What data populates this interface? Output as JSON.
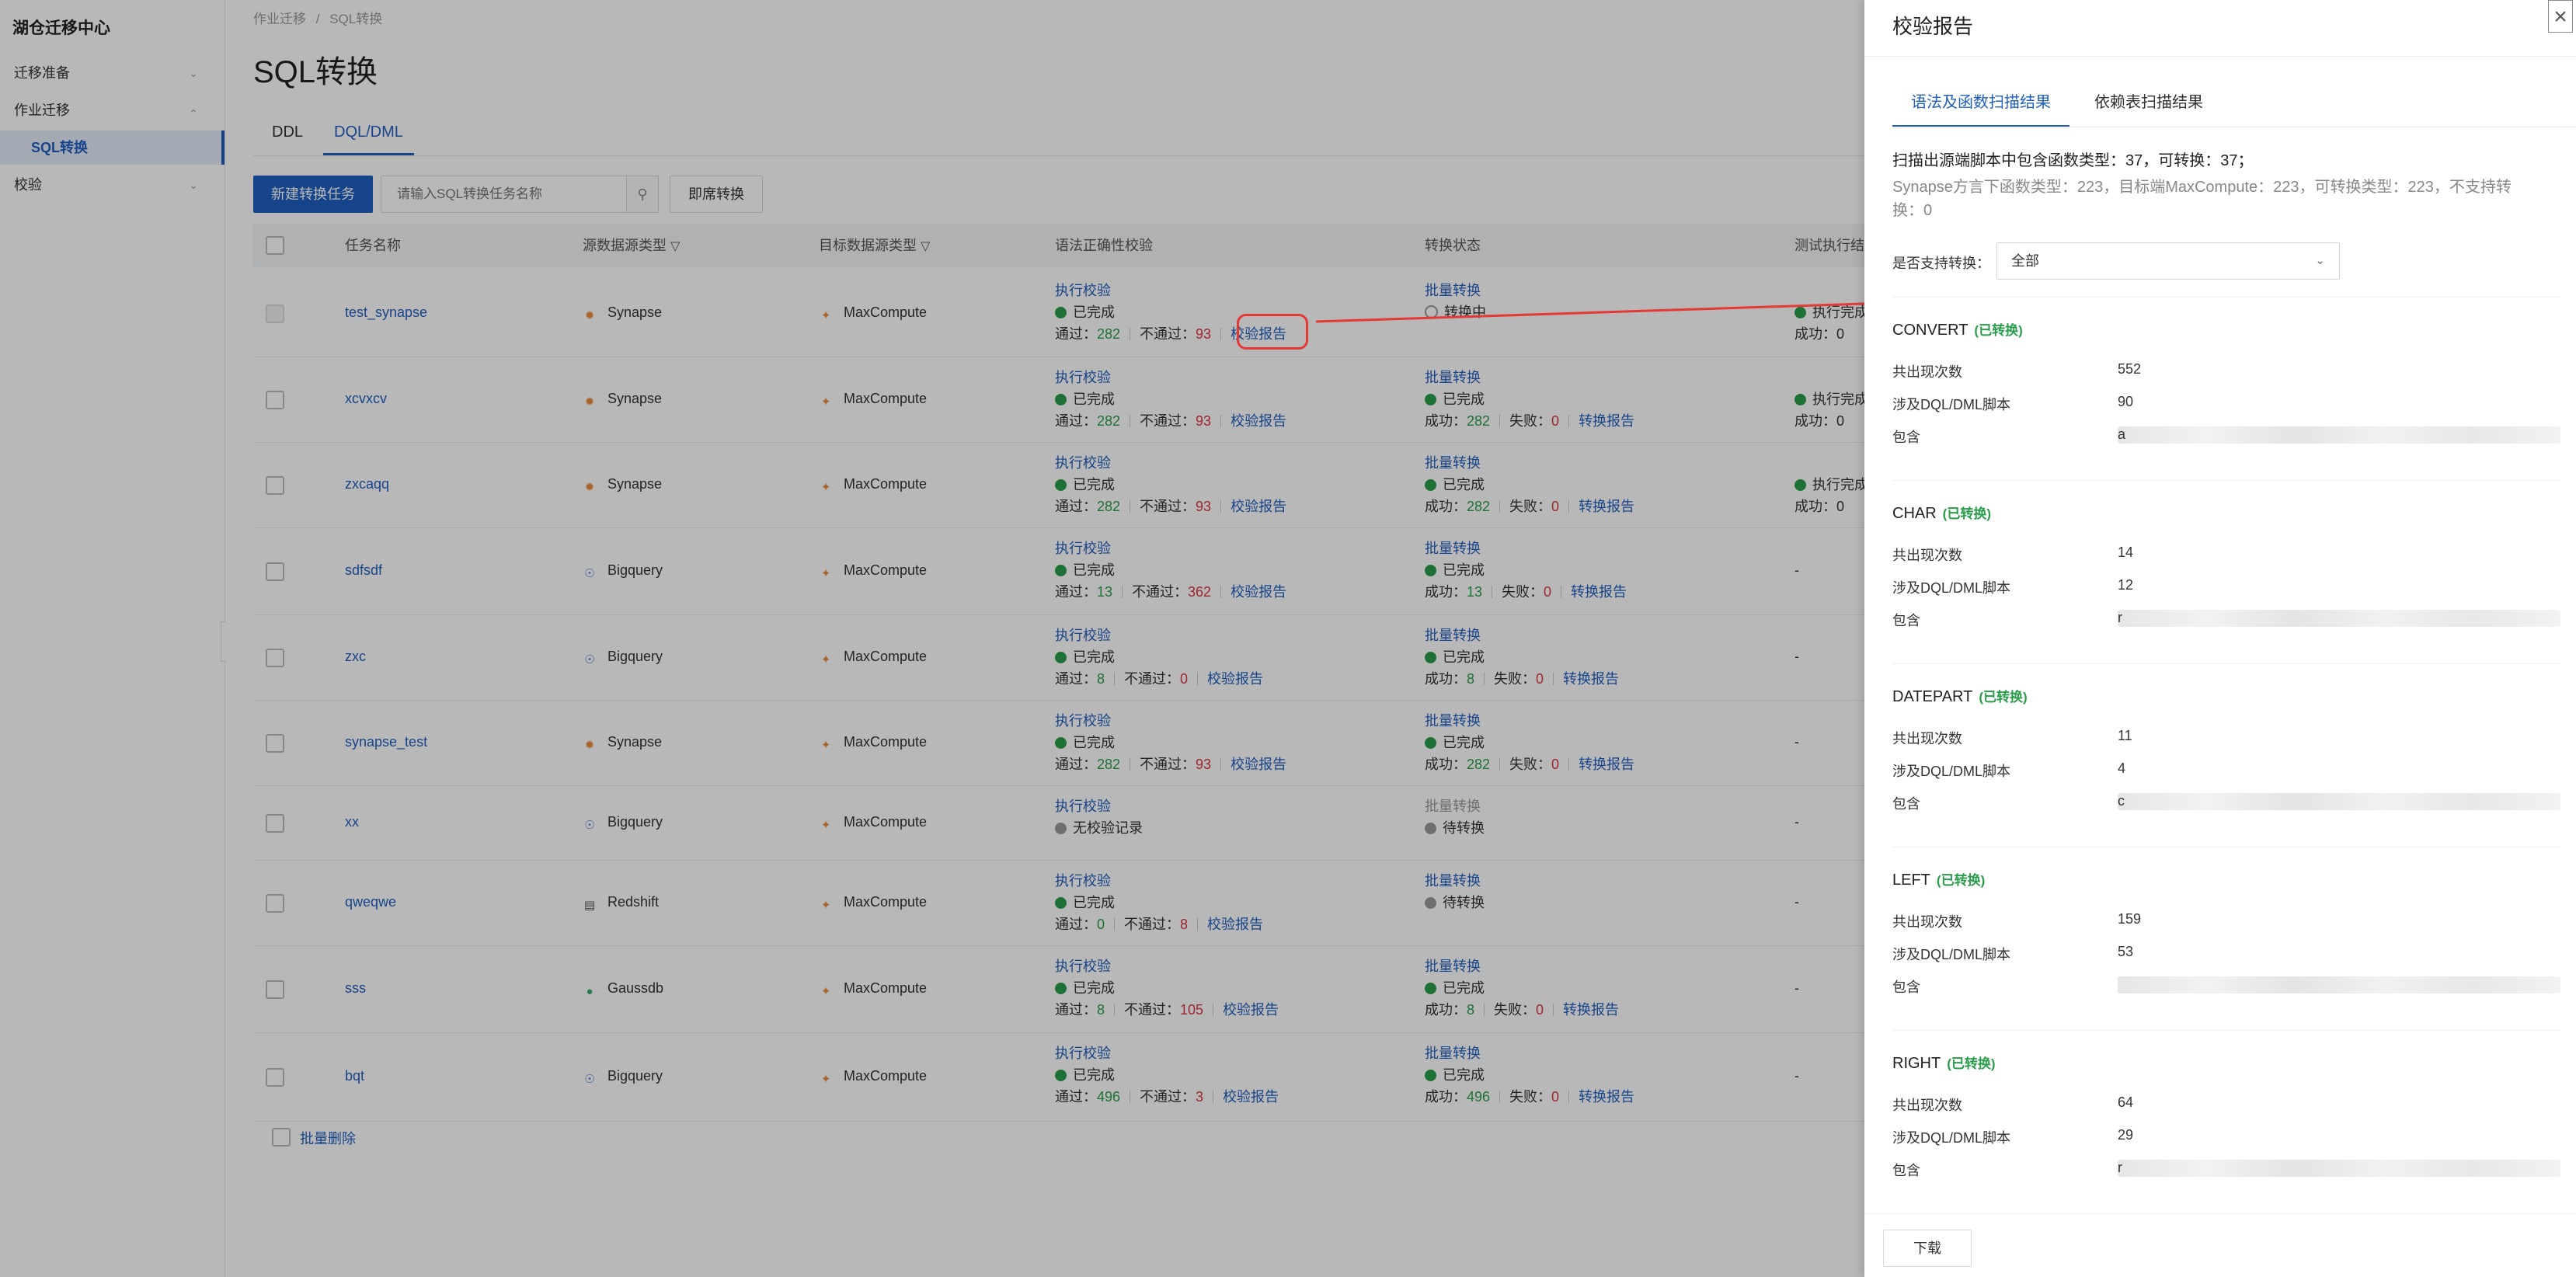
{
  "sidebar": {
    "app_title": "湖仓迁移中心",
    "items": [
      {
        "label": "迁移准备"
      },
      {
        "label": "作业迁移"
      },
      {
        "label": "SQL转换"
      },
      {
        "label": "校验"
      }
    ]
  },
  "breadcrumb": {
    "first": "作业迁移",
    "separator": "/",
    "current": "SQL转换"
  },
  "page": {
    "title": "SQL转换"
  },
  "tabs": [
    {
      "label": "DDL"
    },
    {
      "label": "DQL/DML"
    }
  ],
  "toolbar": {
    "create_label": "新建转换任务",
    "search_placeholder": "请输入SQL转换任务名称",
    "instant_label": "即席转换"
  },
  "table": {
    "columns": {
      "name": "任务名称",
      "source": "源数据源类型",
      "target": "目标数据源类型",
      "syntax_check": "语法正确性校验",
      "convert_status": "转换状态",
      "test_exec": "测试执行结"
    },
    "rows": [
      {
        "name": "test_synapse",
        "source": "Synapse",
        "target": "MaxCompute",
        "check_action": "执行校验",
        "check_status": "已完成",
        "pass_label": "通过：",
        "pass": "282",
        "fail_label": "不通过：",
        "fail": "93",
        "report": "校验报告",
        "conv_action": "批量转换",
        "conv_status": "转换中",
        "test_status": "执行完成",
        "test_success": "成功：0"
      },
      {
        "name": "xcvxcv",
        "source": "Synapse",
        "target": "MaxCompute",
        "check_action": "执行校验",
        "check_status": "已完成",
        "pass_label": "通过：",
        "pass": "282",
        "fail_label": "不通过：",
        "fail": "93",
        "report": "校验报告",
        "conv_action": "批量转换",
        "conv_status": "已完成",
        "succ_label": "成功：",
        "succ": "282",
        "cfail_label": "失败：",
        "cfail": "0",
        "conv_report": "转换报告",
        "test_status": "执行完成",
        "test_success": "成功：0"
      },
      {
        "name": "zxcaqq",
        "source": "Synapse",
        "target": "MaxCompute",
        "check_action": "执行校验",
        "check_status": "已完成",
        "pass_label": "通过：",
        "pass": "282",
        "fail_label": "不通过：",
        "fail": "93",
        "report": "校验报告",
        "conv_action": "批量转换",
        "conv_status": "已完成",
        "succ_label": "成功：",
        "succ": "282",
        "cfail_label": "失败：",
        "cfail": "0",
        "conv_report": "转换报告",
        "test_status": "执行完成",
        "test_success": "成功：0"
      },
      {
        "name": "sdfsdf",
        "source": "Bigquery",
        "target": "MaxCompute",
        "check_action": "执行校验",
        "check_status": "已完成",
        "pass_label": "通过：",
        "pass": "13",
        "fail_label": "不通过：",
        "fail": "362",
        "report": "校验报告",
        "conv_action": "批量转换",
        "conv_status": "已完成",
        "succ_label": "成功：",
        "succ": "13",
        "cfail_label": "失败：",
        "cfail": "0",
        "conv_report": "转换报告",
        "test_dash": "-"
      },
      {
        "name": "zxc",
        "source": "Bigquery",
        "target": "MaxCompute",
        "check_action": "执行校验",
        "check_status": "已完成",
        "pass_label": "通过：",
        "pass": "8",
        "fail_label": "不通过：",
        "fail": "0",
        "report": "校验报告",
        "conv_action": "批量转换",
        "conv_status": "已完成",
        "succ_label": "成功：",
        "succ": "8",
        "cfail_label": "失败：",
        "cfail": "0",
        "conv_report": "转换报告",
        "test_dash": "-"
      },
      {
        "name": "synapse_test",
        "source": "Synapse",
        "target": "MaxCompute",
        "check_action": "执行校验",
        "check_status": "已完成",
        "pass_label": "通过：",
        "pass": "282",
        "fail_label": "不通过：",
        "fail": "93",
        "report": "校验报告",
        "conv_action": "批量转换",
        "conv_status": "已完成",
        "succ_label": "成功：",
        "succ": "282",
        "cfail_label": "失败：",
        "cfail": "0",
        "conv_report": "转换报告",
        "test_dash": "-"
      },
      {
        "name": "xx",
        "source": "Bigquery",
        "target": "MaxCompute",
        "check_action": "执行校验",
        "check_status": "无校验记录",
        "conv_action": "批量转换",
        "conv_status": "待转换",
        "test_dash": "-"
      },
      {
        "name": "qweqwe",
        "source": "Redshift",
        "target": "MaxCompute",
        "check_action": "执行校验",
        "check_status": "已完成",
        "pass_label": "通过：",
        "pass": "0",
        "fail_label": "不通过：",
        "fail": "8",
        "report": "校验报告",
        "conv_action": "批量转换",
        "conv_status": "待转换",
        "test_dash": "-"
      },
      {
        "name": "sss",
        "source": "Gaussdb",
        "target": "MaxCompute",
        "check_action": "执行校验",
        "check_status": "已完成",
        "pass_label": "通过：",
        "pass": "8",
        "fail_label": "不通过：",
        "fail": "105",
        "report": "校验报告",
        "conv_action": "批量转换",
        "conv_status": "已完成",
        "succ_label": "成功：",
        "succ": "8",
        "cfail_label": "失败：",
        "cfail": "0",
        "conv_report": "转换报告",
        "test_dash": "-"
      },
      {
        "name": "bqt",
        "source": "Bigquery",
        "target": "MaxCompute",
        "check_action": "执行校验",
        "check_status": "已完成",
        "pass_label": "通过：",
        "pass": "496",
        "fail_label": "不通过：",
        "fail": "3",
        "report": "校验报告",
        "conv_action": "批量转换",
        "conv_status": "已完成",
        "succ_label": "成功：",
        "succ": "496",
        "cfail_label": "失败：",
        "cfail": "0",
        "conv_report": "转换报告",
        "test_dash": "-"
      }
    ],
    "batch_delete": "批量删除"
  },
  "drawer": {
    "title": "校验报告",
    "close": "×",
    "tabs": [
      {
        "label": "语法及函数扫描结果"
      },
      {
        "label": "依赖表扫描结果"
      }
    ],
    "summary1": "扫描出源端脚本中包含函数类型：37，可转换：37；",
    "summary2": "Synapse方言下函数类型：223，目标端MaxCompute：223，可转换类型：223，不支持转换：0",
    "filter_label": "是否支持转换：",
    "filter_value": "全部",
    "labels": {
      "occurrences": "共出现次数",
      "scripts": "涉及DQL/DML脚本",
      "contains": "包含"
    },
    "functions": [
      {
        "name": "CONVERT",
        "tag": "(已转换)",
        "occurrences": "552",
        "scripts": "90",
        "contains_start": "a"
      },
      {
        "name": "CHAR",
        "tag": "(已转换)",
        "occurrences": "14",
        "scripts": "12",
        "contains_start": "r"
      },
      {
        "name": "DATEPART",
        "tag": "(已转换)",
        "occurrences": "11",
        "scripts": "4",
        "contains_start": "c"
      },
      {
        "name": "LEFT",
        "tag": "(已转换)",
        "occurrences": "159",
        "scripts": "53",
        "contains_start": ""
      },
      {
        "name": "RIGHT",
        "tag": "(已转换)",
        "occurrences": "64",
        "scripts": "29",
        "contains_start": "r"
      }
    ],
    "download": "下载"
  }
}
